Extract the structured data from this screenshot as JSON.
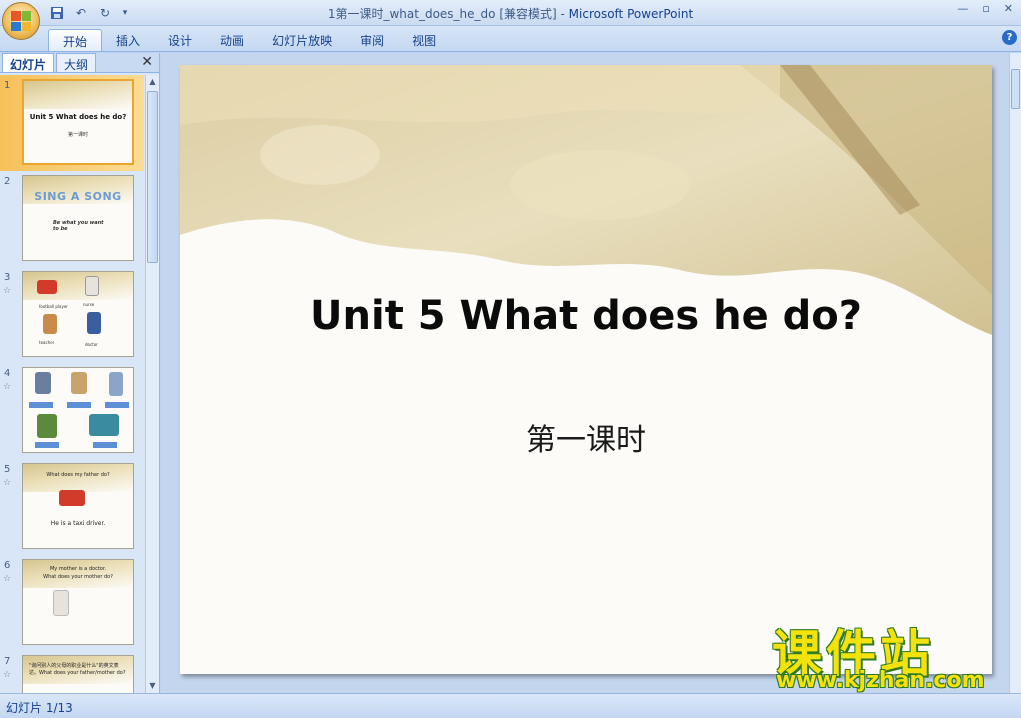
{
  "window": {
    "title": "1第一课时_what_does_he_do [兼容模式]",
    "title_separator": " - ",
    "app_name": "Microsoft PowerPoint"
  },
  "ribbon": {
    "tabs": [
      {
        "label": "开始",
        "active": true
      },
      {
        "label": "插入"
      },
      {
        "label": "设计"
      },
      {
        "label": "动画"
      },
      {
        "label": "幻灯片放映"
      },
      {
        "label": "审阅"
      },
      {
        "label": "视图"
      }
    ],
    "help_label": "?"
  },
  "panel": {
    "tabs": [
      {
        "label": "幻灯片",
        "active": true
      },
      {
        "label": "大纲"
      }
    ],
    "close_label": "✕"
  },
  "thumbnails": [
    {
      "number": "1",
      "title": "Unit 5 What does he do?",
      "subtitle": "第一课时"
    },
    {
      "number": "2",
      "heading": "SING A SONG",
      "text": "Be what you want to be"
    },
    {
      "number": "3",
      "labels": [
        "football player",
        "nurse",
        "teacher",
        "doctor"
      ]
    },
    {
      "number": "4",
      "labels": [
        "businessman",
        "football player",
        "factory worker",
        "postman",
        "police"
      ]
    },
    {
      "number": "5",
      "top": "What does my father do?",
      "caption": "He is a taxi driver."
    },
    {
      "number": "6",
      "line1": "My mother is a doctor.",
      "line2": "What does your mother do?"
    },
    {
      "number": "7",
      "line1": "\"询问别人的父母的职业是什么\"的英文表达。What does your father/mother do?"
    }
  ],
  "slide": {
    "title": "Unit 5 What does he do?",
    "subtitle": "第一课时"
  },
  "watermark": {
    "text": "课件站",
    "url": "www.kjzhan.com"
  },
  "status": {
    "label": "幻灯片 1/13"
  },
  "colors": {
    "ribbon_bg": "#c4d8f1",
    "selected_thumb": "#f7c05a",
    "watermark": "#f4e20c"
  }
}
